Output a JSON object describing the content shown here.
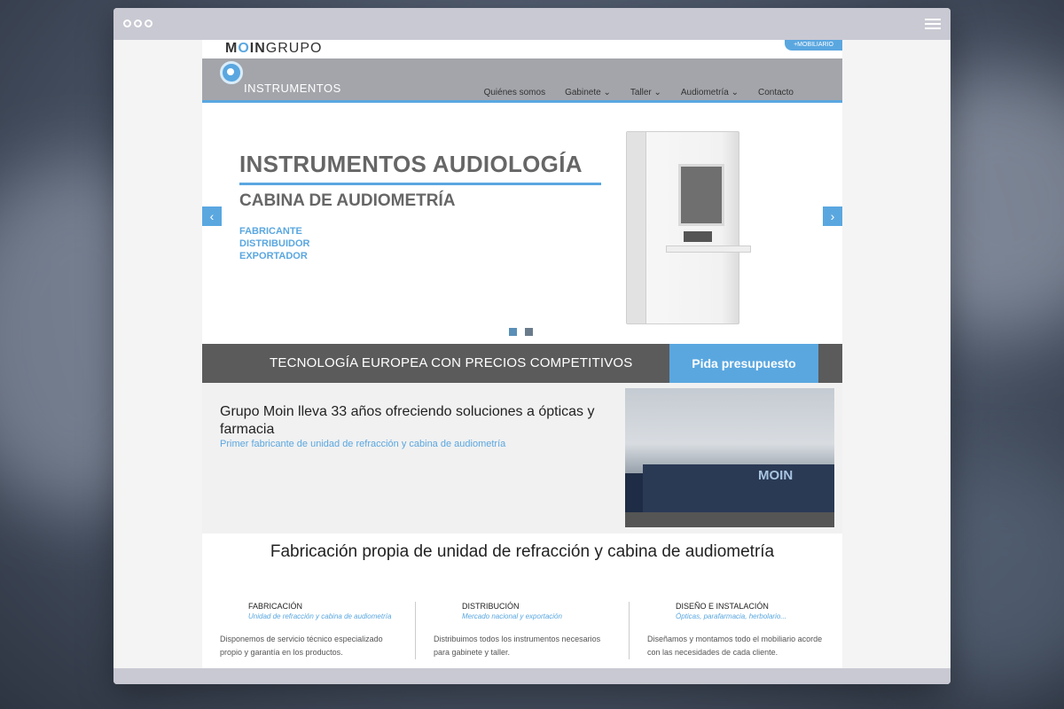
{
  "window": {
    "menu_icon": "hamburger-icon"
  },
  "header": {
    "logo_bold": "M",
    "logo_o": "O",
    "logo_bold2": "IN",
    "logo_light": "GRUPO",
    "mobiliario": "+MOBILIARIO",
    "brand": "INSTRUMENTOS",
    "nav": [
      {
        "label": "Quiénes somos"
      },
      {
        "label": "Gabinete ⌄"
      },
      {
        "label": "Taller ⌄"
      },
      {
        "label": "Audiometría ⌄"
      },
      {
        "label": "Contacto"
      }
    ]
  },
  "slider": {
    "title": "INSTRUMENTOS AUDIOLOGÍA",
    "subtitle": "CABINA DE AUDIOMETRÍA",
    "list": [
      "FABRICANTE",
      "DISTRIBUIDOR",
      "EXPORTADOR"
    ],
    "prev": "‹",
    "next": "›",
    "colors": {
      "accent": "#5aa7e0"
    }
  },
  "banner": {
    "text": "TECNOLOGÍA EUROPEA CON PRECIOS COMPETITIVOS",
    "button": "Pida presupuesto"
  },
  "intro": {
    "title": "Grupo Moin lleva 33 años ofreciendo soluciones a ópticas y farmacia",
    "subtitle": "Primer fabricante de unidad de refracción y cabina de audiometría",
    "photo_sign": "MOIN"
  },
  "features": {
    "title": "Fabricación propia de unidad de refracción y cabina de audiometría",
    "items": [
      {
        "heading": "FABRICACIÓN",
        "tag": "Unidad de refracción y cabina de audiometría",
        "text": "Disponemos de servicio técnico especializado propio y garantía en los productos."
      },
      {
        "heading": "DISTRIBUCIÓN",
        "tag": "Mercado nacional y exportación",
        "text": "Distribuimos todos los instrumentos necesarios para gabinete y taller."
      },
      {
        "heading": "DISEÑO E INSTALACIÓN",
        "tag": "Ópticas, parafarmacia, herbolario...",
        "text": "Diseñamos y montamos todo el mobiliario acorde con las necesidades de cada cliente."
      }
    ]
  }
}
